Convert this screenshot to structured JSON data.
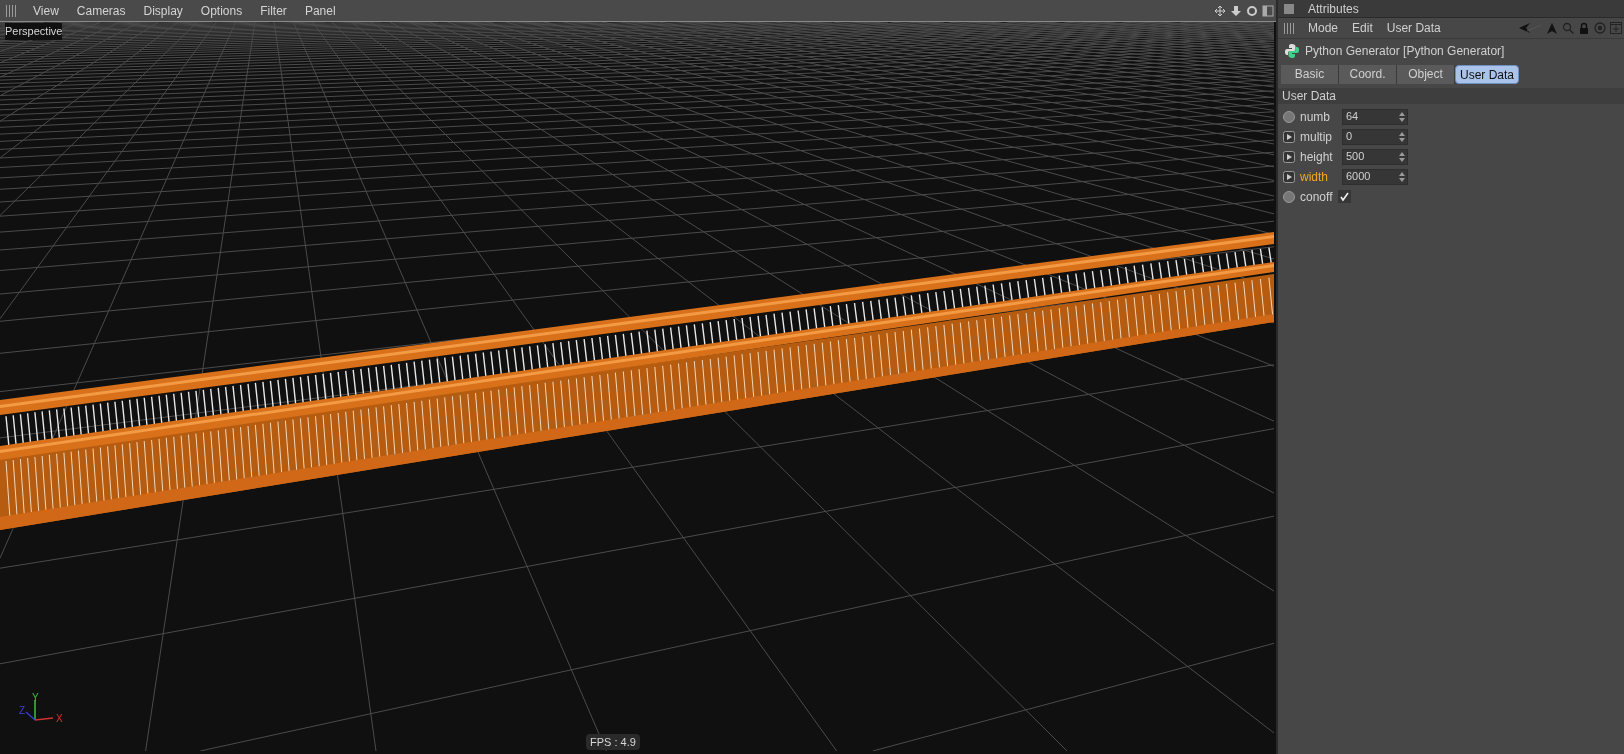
{
  "viewport": {
    "menu": [
      "View",
      "Cameras",
      "Display",
      "Options",
      "Filter",
      "Panel"
    ],
    "camera_label": "Perspective",
    "fps": "FPS : 4.9",
    "axis_labels": {
      "x": "X",
      "y": "Y",
      "z": "Z"
    }
  },
  "attributes": {
    "title": "Attributes",
    "menu": [
      "Mode",
      "Edit",
      "User Data"
    ],
    "object_name": "Python Generator [Python Generator]",
    "tabs": [
      {
        "label": "Basic",
        "selected": false
      },
      {
        "label": "Coord.",
        "selected": false
      },
      {
        "label": "Object",
        "selected": false
      },
      {
        "label": "User Data",
        "selected": true
      }
    ],
    "section": "User Data",
    "params": [
      {
        "kind": "spinner",
        "animatable": false,
        "label": "numb",
        "value": "64",
        "highlighted": false
      },
      {
        "kind": "spinner",
        "animatable": true,
        "label": "multip",
        "value": "0",
        "highlighted": false
      },
      {
        "kind": "spinner",
        "animatable": true,
        "label": "height",
        "value": "500",
        "highlighted": false
      },
      {
        "kind": "spinner",
        "animatable": true,
        "label": "width",
        "value": "6000",
        "highlighted": true
      },
      {
        "kind": "checkbox",
        "animatable": false,
        "label": "conoff",
        "checked": true,
        "highlighted": false
      }
    ]
  }
}
